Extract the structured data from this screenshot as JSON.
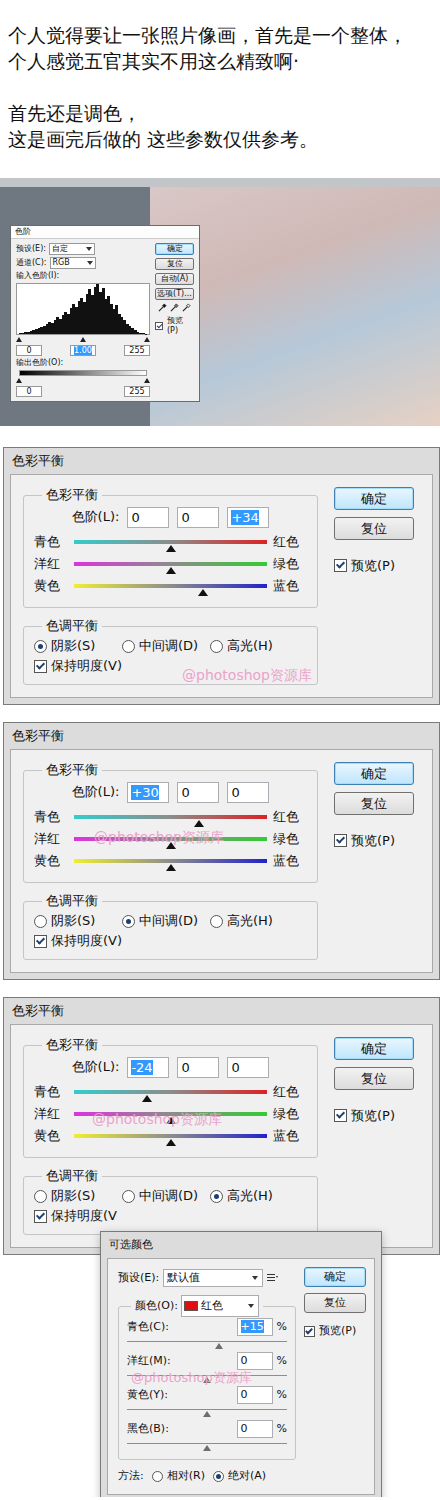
{
  "intro": {
    "paragraphs": [
      [
        "个人觉得要让一张照片像画，首先是一个整体，",
        "个人感觉五官其实不用这么精致啊·"
      ],
      [
        "首先还是调色，",
        "这是画完后做的 这些参数仅供参考。"
      ]
    ]
  },
  "levels_dialog": {
    "title": "色阶",
    "preset_label": "预设(E):",
    "preset": "自定",
    "channel_label": "通道(C):",
    "channel": "RGB",
    "input_label": "输入色阶(I):",
    "histogram": [
      2,
      3,
      4,
      5,
      6,
      8,
      10,
      12,
      14,
      16,
      20,
      24,
      22,
      28,
      34,
      30,
      38,
      45,
      40,
      52,
      60,
      55,
      66,
      72,
      64,
      80,
      90,
      78,
      95,
      100,
      85,
      92,
      70,
      76,
      60,
      50,
      58,
      40,
      34,
      28,
      20,
      16,
      12,
      8,
      5,
      3,
      2,
      1
    ],
    "input_thumbs": [
      0,
      0.5,
      1
    ],
    "input_values": [
      {
        "text": "0",
        "selected": false
      },
      {
        "text": "1.00",
        "selected": true
      },
      {
        "text": "255",
        "selected": false
      }
    ],
    "output_label": "输出色阶(O):",
    "output_thumbs": [
      0,
      1
    ],
    "output_values": [
      {
        "text": "0",
        "selected": false
      },
      {
        "text": "255",
        "selected": false
      }
    ],
    "buttons": [
      {
        "label": "确定",
        "default": true
      },
      {
        "label": "复位",
        "default": false
      },
      {
        "label": "自动(A)",
        "default": false
      },
      {
        "label": "选项(T)...",
        "default": false
      }
    ],
    "preview": {
      "label": "预览(P)",
      "checked": true
    }
  },
  "color_balance_dialogs": [
    {
      "title": "色彩平衡",
      "group_title": "色彩平衡",
      "levels_label": "色阶(L):",
      "values": [
        {
          "text": "0",
          "selected": false
        },
        {
          "text": "0",
          "selected": false
        },
        {
          "text": "+34",
          "selected": true
        }
      ],
      "sliders": [
        {
          "left": "青色",
          "right": "红色",
          "level": 0.5,
          "color_from": "#33cccc",
          "color_to": "#dd2222"
        },
        {
          "left": "洋红",
          "right": "绿色",
          "level": 0.5,
          "color_from": "#dd33dd",
          "color_to": "#33cc33"
        },
        {
          "left": "黄色",
          "right": "蓝色",
          "level": 0.67,
          "color_from": "#eeee33",
          "color_to": "#2222cc"
        }
      ],
      "tone_title": "色调平衡",
      "tones": [
        {
          "label": "阴影(S)",
          "selected": true
        },
        {
          "label": "中间调(D)",
          "selected": false
        },
        {
          "label": "高光(H)",
          "selected": false
        }
      ],
      "preserve": {
        "label": "保持明度(V)",
        "checked": true
      },
      "buttons": [
        {
          "label": "确定",
          "default": true
        },
        {
          "label": "复位",
          "default": false
        }
      ],
      "preview": {
        "label": "预览(P)",
        "checked": true
      },
      "watermark": "@photoshop资源库"
    },
    {
      "title": "色彩平衡",
      "group_title": "色彩平衡",
      "levels_label": "色阶(L):",
      "values": [
        {
          "text": "+30",
          "selected": true
        },
        {
          "text": "0",
          "selected": false
        },
        {
          "text": "0",
          "selected": false
        }
      ],
      "sliders": [
        {
          "left": "青色",
          "right": "红色",
          "level": 0.65,
          "color_from": "#33cccc",
          "color_to": "#dd2222"
        },
        {
          "left": "洋红",
          "right": "绿色",
          "level": 0.5,
          "color_from": "#dd33dd",
          "color_to": "#33cc33"
        },
        {
          "left": "黄色",
          "right": "蓝色",
          "level": 0.5,
          "color_from": "#eeee33",
          "color_to": "#2222cc"
        }
      ],
      "tone_title": "色调平衡",
      "tones": [
        {
          "label": "阴影(S)",
          "selected": false
        },
        {
          "label": "中间调(D)",
          "selected": true
        },
        {
          "label": "高光(H)",
          "selected": false
        }
      ],
      "preserve": {
        "label": "保持明度(V)",
        "checked": true
      },
      "buttons": [
        {
          "label": "确定",
          "default": true
        },
        {
          "label": "复位",
          "default": false
        }
      ],
      "preview": {
        "label": "预览(P)",
        "checked": true
      },
      "watermark": "@photoshop资源库"
    },
    {
      "title": "色彩平衡",
      "group_title": "色彩平衡",
      "levels_label": "色阶(L):",
      "values": [
        {
          "text": "-24",
          "selected": true
        },
        {
          "text": "0",
          "selected": false
        },
        {
          "text": "0",
          "selected": false
        }
      ],
      "sliders": [
        {
          "left": "青色",
          "right": "红色",
          "level": 0.38,
          "color_from": "#33cccc",
          "color_to": "#dd2222"
        },
        {
          "left": "洋红",
          "right": "绿色",
          "level": 0.5,
          "color_from": "#dd33dd",
          "color_to": "#33cc33"
        },
        {
          "left": "黄色",
          "right": "蓝色",
          "level": 0.5,
          "color_from": "#eeee33",
          "color_to": "#2222cc"
        }
      ],
      "tone_title": "色调平衡",
      "tones": [
        {
          "label": "阴影(S)",
          "selected": false
        },
        {
          "label": "中间调(D)",
          "selected": false
        },
        {
          "label": "高光(H)",
          "selected": true
        }
      ],
      "preserve": {
        "label": "保持明度(V",
        "checked": true
      },
      "buttons": [
        {
          "label": "确定",
          "default": true
        },
        {
          "label": "复位",
          "default": false
        }
      ],
      "preview": {
        "label": "预览(P)",
        "checked": true
      },
      "watermark": "@photoshop资源库"
    }
  ],
  "selective_color_dialog": {
    "title": "可选颜色",
    "preset_label": "预设(E):",
    "preset": "默认值",
    "color_label": "颜色(O):",
    "swatch": {
      "name": "红色",
      "color": "#e01010"
    },
    "sliders": [
      {
        "label": "青色(C):",
        "value": "+15",
        "unit": "%",
        "selected": true,
        "level": 0.575
      },
      {
        "label": "洋红(M):",
        "value": "0",
        "unit": "%",
        "selected": false,
        "level": 0.5
      },
      {
        "label": "黄色(Y):",
        "value": "0",
        "unit": "%",
        "selected": false,
        "level": 0.5
      },
      {
        "label": "黑色(B):",
        "value": "0",
        "unit": "%",
        "selected": false,
        "level": 0.5
      }
    ],
    "method_label": "方法:",
    "methods": [
      {
        "label": "相对(R)",
        "selected": false
      },
      {
        "label": "绝对(A)",
        "selected": true
      }
    ],
    "buttons": [
      {
        "label": "确定",
        "default": true
      },
      {
        "label": "复位",
        "default": false
      }
    ],
    "preview": {
      "label": "预览(P)",
      "checked": true
    },
    "watermark": "@photoshop资源库"
  }
}
